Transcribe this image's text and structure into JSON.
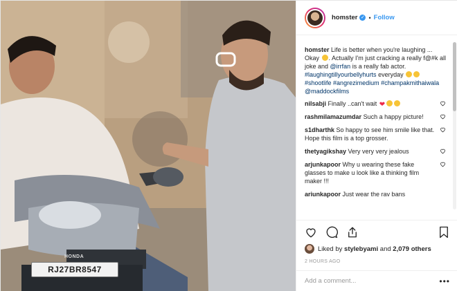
{
  "post": {
    "photo": {
      "plate_text": "RJ27BR8547",
      "brand_text": "HONDA"
    },
    "header": {
      "username": "homster",
      "verified_icon": "verified-badge-icon",
      "separator": "•",
      "follow_label": "Follow"
    },
    "caption": {
      "username": "homster",
      "parts": {
        "t1": "Life is better when you're laughing ... Okay",
        "t2": ". Actually I'm just cracking a really f@#k all joke and",
        "mention": "@irrfan",
        "t3": "is a really fab actor.",
        "h1": "#laughingtillyourbellyhurts",
        "t4": "everyday",
        "h2": "#shootlife",
        "h3": "#angrezimedium",
        "h4": "#champakmithaiwala",
        "h5": "@maddockfilms"
      }
    },
    "comments": [
      {
        "user": "nilsabji",
        "text": "Finally ..can't wait"
      },
      {
        "user": "rashmilamazumdar",
        "text": "Such a happy picture!"
      },
      {
        "user": "s1dharthk",
        "text": "So happy to see him smile like that. Hope this film is a top grosser."
      },
      {
        "user": "thetyagikshay",
        "text": "Very very very jealous"
      },
      {
        "user": "arjunkapoor",
        "text": "Why u wearing these fake glasses to make u look like a thinking film maker !!!"
      },
      {
        "user": "ariunkapoor",
        "text": "Just wear the rav bans"
      }
    ],
    "likes": {
      "prefix": "Liked by",
      "user": "stylebyami",
      "and": "and",
      "count": "2,079 others"
    },
    "timestamp": "2 HOURS AGO",
    "add_comment": {
      "placeholder": "Add a comment...",
      "more_icon": "•••"
    },
    "icons": [
      "heart-icon",
      "comment-icon",
      "share-icon",
      "bookmark-icon"
    ]
  }
}
